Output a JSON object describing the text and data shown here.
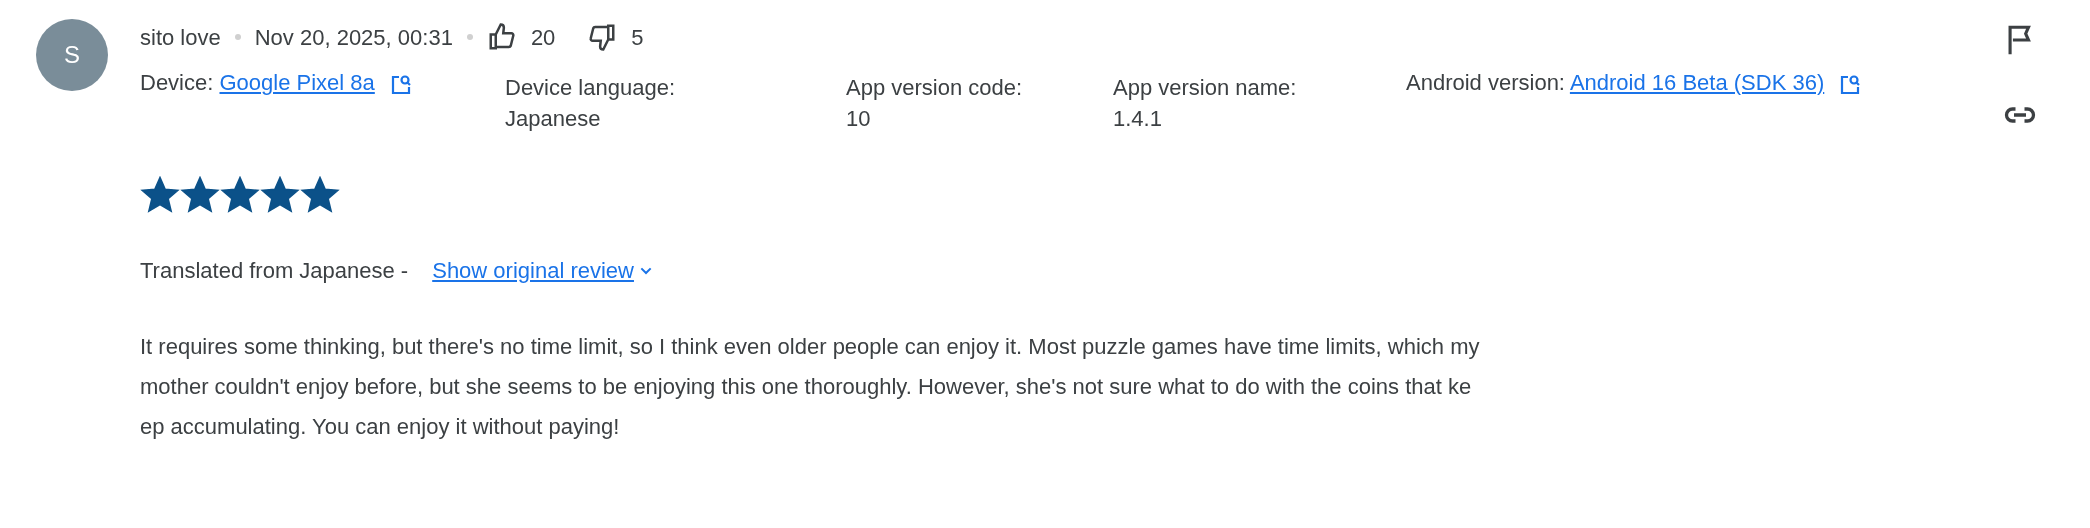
{
  "review": {
    "avatar_letter": "S",
    "author": "sito love",
    "date": "Nov 20, 2025, 00:31",
    "thumbs_up": "20",
    "thumbs_down": "5",
    "details": [
      {
        "kind": "device",
        "label": "Device:",
        "link": "Google Pixel 8a"
      },
      {
        "kind": "text",
        "label": "Device language:",
        "value": "Japanese"
      },
      {
        "kind": "text",
        "label": "App version code:",
        "value": "10"
      },
      {
        "kind": "text",
        "label": "App version name:",
        "value": "1.4.1"
      },
      {
        "kind": "device",
        "label": "Android version:",
        "link": "Android 16 Beta (SDK 36)"
      }
    ],
    "stars": 5,
    "translation_note": "Translated from Japanese -",
    "show_original_link": "Show original review",
    "body_lines": [
      "It requires some thinking, but there's no time limit, so I think even older people can enjoy it. Most puzzle games have time limits, which my",
      "mother couldn't enjoy before, but she seems to be enjoying this one thoroughly. However, she's not sure what to do with the coins that ke",
      "ep accumulating. You can enjoy it without paying!"
    ]
  }
}
